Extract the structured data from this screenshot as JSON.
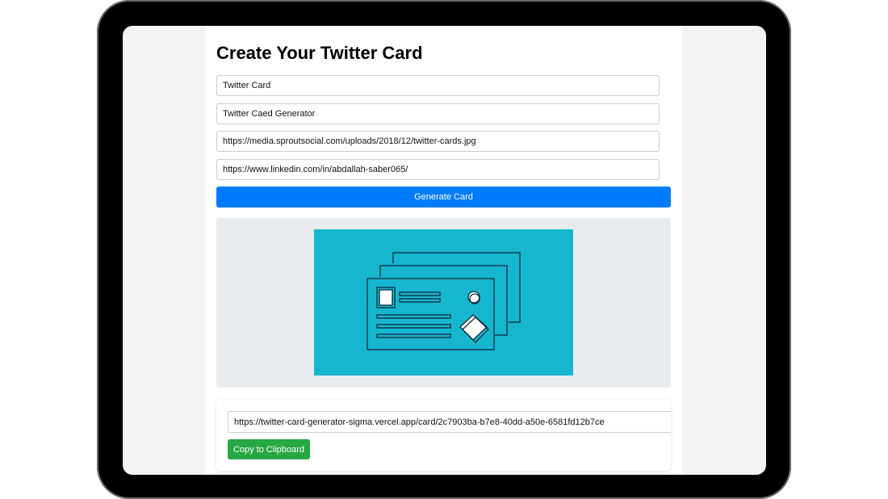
{
  "page": {
    "title": "Create Your Twitter Card"
  },
  "form": {
    "fields": [
      {
        "name": "title",
        "value": "Twitter Card"
      },
      {
        "name": "description",
        "value": "Twitter Caed Generator"
      },
      {
        "name": "image-url",
        "value": "https://media.sproutsocial.com/uploads/2018/12/twitter-cards.jpg"
      },
      {
        "name": "link-url",
        "value": "https://www.linkedin.com/in/abdallah-saber065/"
      }
    ],
    "generate_label": "Generate Card"
  },
  "preview": {
    "image_icon": "card-stack-illustration"
  },
  "result": {
    "card_url": "https://twitter-card-generator-sigma.vercel.app/card/2c7903ba-b7e8-40dd-a50e-6581fd12b7ce",
    "copy_label": "Copy to Clipboard"
  },
  "colors": {
    "primary": "#007bff",
    "success": "#28a745",
    "preview_bg": "#e9ecef",
    "image_bg": "#17b6cf"
  }
}
